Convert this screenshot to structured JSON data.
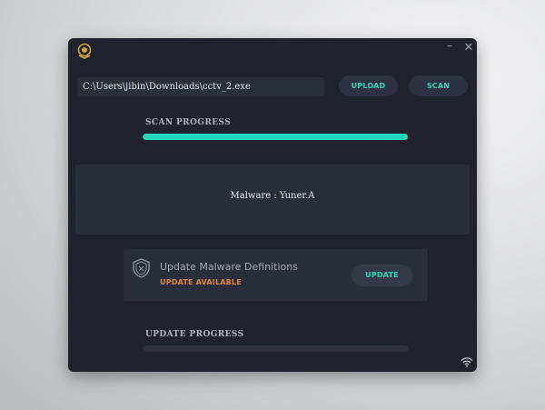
{
  "window": {
    "minimize_label": "–",
    "close_label": "✕",
    "logo_icon": "shield-badge-logo-icon"
  },
  "file": {
    "path_value": "C:\\Users\\jibin\\Downloads\\cctv_2.exe"
  },
  "toolbar": {
    "upload_label": "UPLOAD",
    "scan_label": "SCAN"
  },
  "scan": {
    "progress_label": "SCAN PROGRESS",
    "progress_percent": 100
  },
  "result": {
    "text": "Malware :  Yuner.A"
  },
  "update_card": {
    "title": "Update Malware Definitions",
    "status": "UPDATE AVAILABLE",
    "button_label": "UPDATE",
    "icon": "shield-icon"
  },
  "update": {
    "progress_label": "UPDATE PROGRESS",
    "progress_percent": 0
  },
  "status_bar": {
    "icon": "wifi-icon"
  },
  "colors": {
    "accent": "#23d9bd",
    "warning": "#e08a2d",
    "background": "#20232d",
    "panel": "#2a2e3b"
  }
}
